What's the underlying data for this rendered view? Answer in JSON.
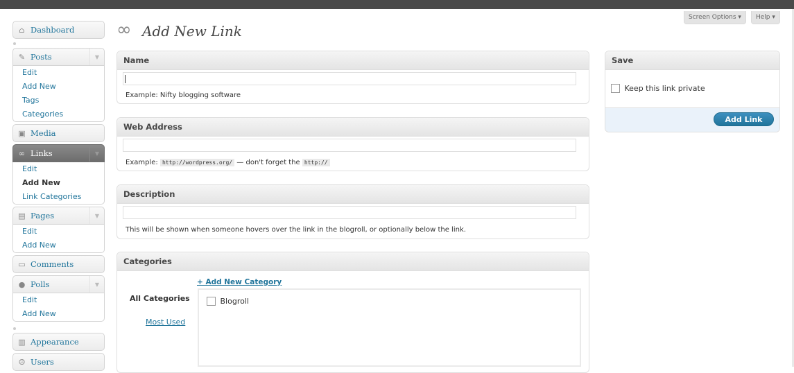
{
  "header": {
    "title": "Add New Link",
    "screen_options": "Screen Options",
    "help": "Help"
  },
  "sidebar": {
    "dashboard": "Dashboard",
    "posts": {
      "label": "Posts",
      "items": [
        "Edit",
        "Add New",
        "Tags",
        "Categories"
      ]
    },
    "media": "Media",
    "links": {
      "label": "Links",
      "items": [
        "Edit",
        "Add New",
        "Link Categories"
      ],
      "current": "Add New"
    },
    "pages": {
      "label": "Pages",
      "items": [
        "Edit",
        "Add New"
      ]
    },
    "comments": "Comments",
    "polls": {
      "label": "Polls",
      "items": [
        "Edit",
        "Add New"
      ]
    },
    "appearance": "Appearance",
    "users": "Users"
  },
  "name_box": {
    "title": "Name",
    "value": "",
    "hint": "Example: Nifty blogging software"
  },
  "web_address_box": {
    "title": "Web Address",
    "value": "",
    "hint_prefix": "Example:",
    "hint_code1": "http://wordpress.org/",
    "hint_middle": "— don't forget the",
    "hint_code2": "http://"
  },
  "description_box": {
    "title": "Description",
    "value": "",
    "hint": "This will be shown when someone hovers over the link in the blogroll, or optionally below the link."
  },
  "categories_box": {
    "title": "Categories",
    "add_new": "+ Add New Category",
    "tab_all": "All Categories",
    "tab_most_used": "Most Used",
    "items": [
      {
        "label": "Blogroll",
        "checked": false
      }
    ]
  },
  "save_box": {
    "title": "Save",
    "private_label": "Keep this link private",
    "private_checked": false,
    "add_link_button": "Add Link"
  },
  "colors": {
    "link": "#21759b",
    "button": "#21759b",
    "topbar": "#4a4a4a"
  }
}
